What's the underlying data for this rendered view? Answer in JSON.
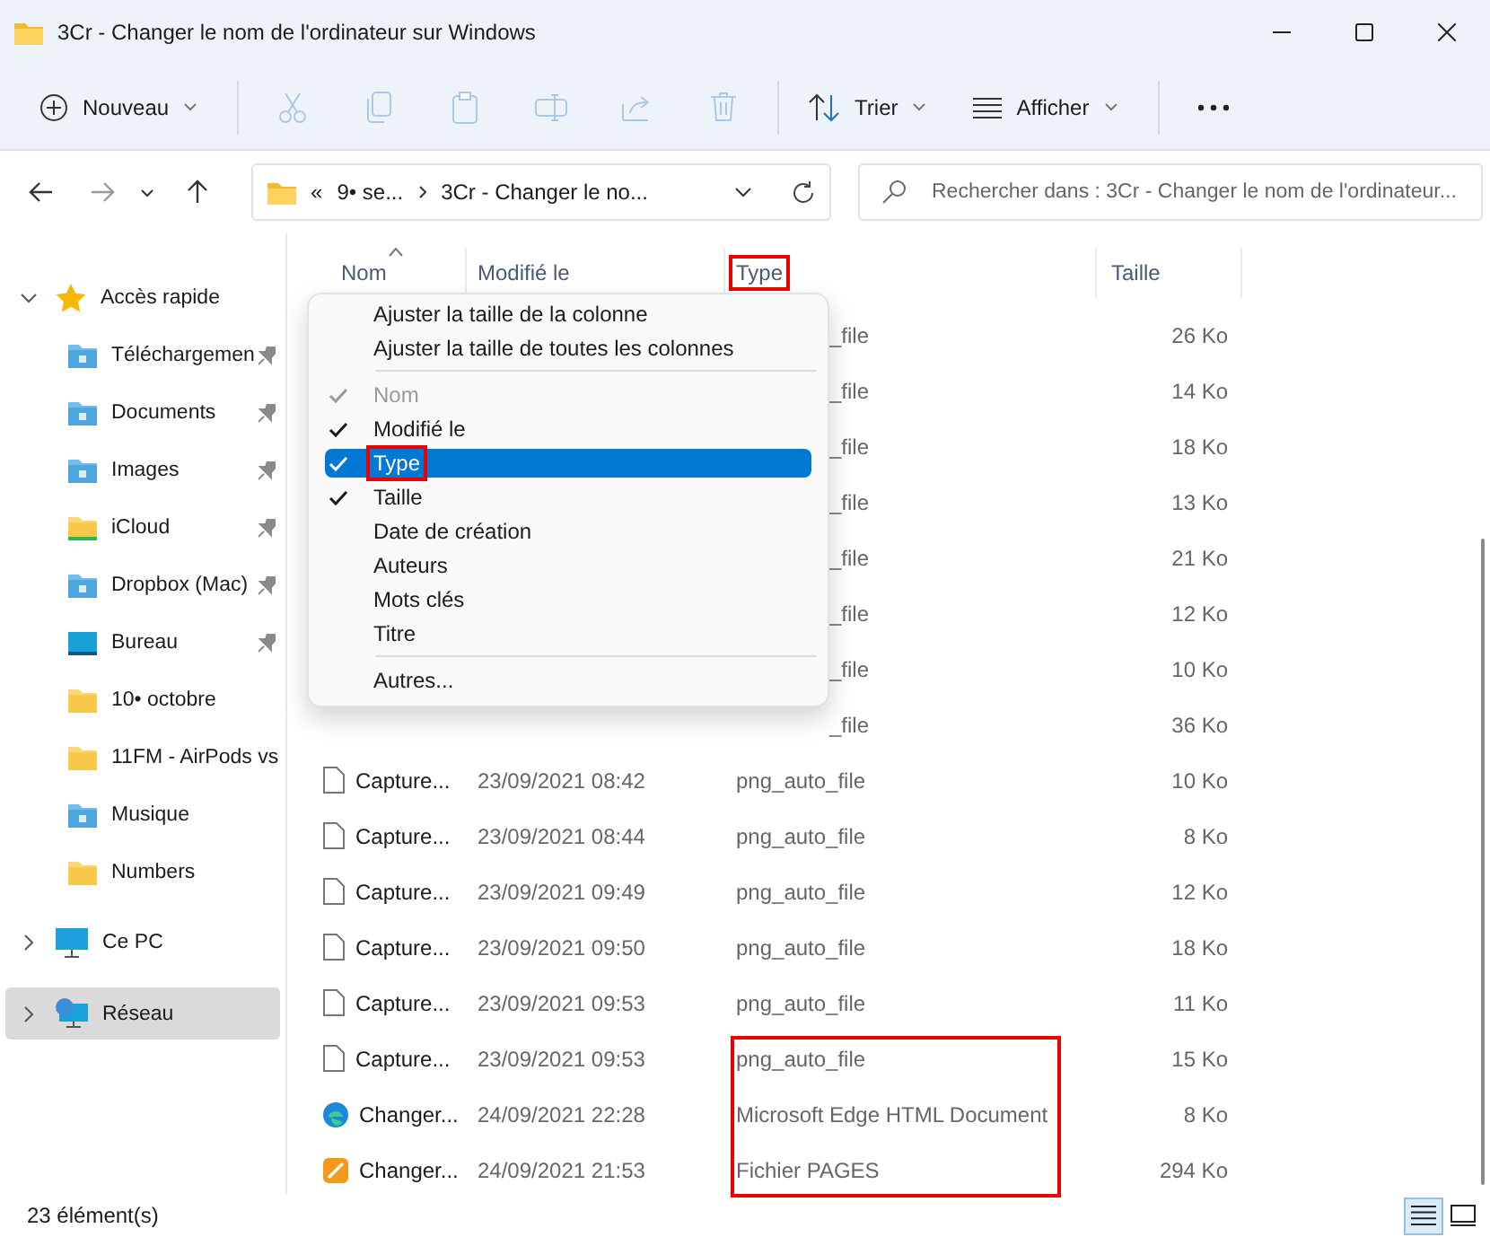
{
  "window": {
    "title": "3Cr - Changer le nom de l'ordinateur sur Windows"
  },
  "toolbar": [
    {
      "kind": "new",
      "label": "Nouveau",
      "disabled": false
    },
    {
      "kind": "separator"
    },
    {
      "kind": "cut",
      "disabled": true
    },
    {
      "kind": "copy",
      "disabled": true
    },
    {
      "kind": "paste",
      "disabled": true
    },
    {
      "kind": "rename",
      "disabled": true
    },
    {
      "kind": "share",
      "disabled": true
    },
    {
      "kind": "delete",
      "disabled": true
    },
    {
      "kind": "separator"
    },
    {
      "kind": "sort",
      "label": "Trier",
      "disabled": false
    },
    {
      "kind": "view",
      "label": "Afficher",
      "disabled": false
    },
    {
      "kind": "separator"
    },
    {
      "kind": "more"
    }
  ],
  "navigation": {
    "back_disabled": false,
    "forward_disabled": true
  },
  "address": {
    "crumbs": [
      "«",
      "9• se...",
      "3Cr - Changer le no..."
    ]
  },
  "search": {
    "placeholder": "Rechercher dans : 3Cr - Changer le nom de l'ordinateur..."
  },
  "sidebar": {
    "items": [
      {
        "label": "Accès rapide",
        "kind": "star",
        "expanded": true,
        "selected": false,
        "children": [
          {
            "label": "Téléchargemen",
            "kind": "download",
            "pinned": true,
            "selected": false
          },
          {
            "label": "Documents",
            "kind": "documents",
            "pinned": true,
            "selected": false
          },
          {
            "label": "Images",
            "kind": "images",
            "pinned": true,
            "selected": false
          },
          {
            "label": "iCloud",
            "kind": "icloud",
            "pinned": true,
            "selected": false
          },
          {
            "label": "Dropbox (Mac)",
            "kind": "dropbox",
            "pinned": true,
            "selected": false
          },
          {
            "label": "Bureau",
            "kind": "desktop",
            "pinned": true,
            "selected": false
          },
          {
            "label": "10• octobre",
            "kind": "folder",
            "pinned": false,
            "selected": false
          },
          {
            "label": "11FM - AirPods vs",
            "kind": "folder",
            "pinned": false,
            "selected": false
          },
          {
            "label": "Musique",
            "kind": "music",
            "pinned": false,
            "selected": false
          },
          {
            "label": "Numbers",
            "kind": "folder",
            "pinned": false,
            "selected": false
          }
        ]
      },
      {
        "label": "Ce PC",
        "kind": "pc",
        "expanded": false,
        "selected": false
      },
      {
        "label": "Réseau",
        "kind": "network",
        "expanded": false,
        "selected": true
      }
    ]
  },
  "file_list": {
    "columns": [
      {
        "label": "Nom",
        "sorted": true,
        "highlighted": false
      },
      {
        "label": "Modifié le",
        "sorted": false,
        "highlighted": false
      },
      {
        "label": "Type",
        "sorted": false,
        "highlighted": true
      },
      {
        "label": "Taille",
        "sorted": false,
        "highlighted": false
      }
    ],
    "rows": [
      {
        "kind": "covered",
        "type": "_file",
        "size": "26 Ko",
        "highlighted": false
      },
      {
        "kind": "covered",
        "type": "_file",
        "size": "14 Ko",
        "highlighted": false
      },
      {
        "kind": "covered",
        "type": "_file",
        "size": "18 Ko",
        "highlighted": false
      },
      {
        "kind": "covered",
        "type": "_file",
        "size": "13 Ko",
        "highlighted": false
      },
      {
        "kind": "covered",
        "type": "_file",
        "size": "21 Ko",
        "highlighted": false
      },
      {
        "kind": "covered",
        "type": "_file",
        "size": "12 Ko",
        "highlighted": false
      },
      {
        "kind": "covered",
        "type": "_file",
        "size": "10 Ko",
        "highlighted": false
      },
      {
        "kind": "covered",
        "type": "_file",
        "size": "36 Ko",
        "highlighted": false
      },
      {
        "kind": "file",
        "name": "Capture...",
        "modified": "23/09/2021 08:42",
        "type": "png_auto_file",
        "size": "10 Ko",
        "highlighted": false
      },
      {
        "kind": "file",
        "name": "Capture...",
        "modified": "23/09/2021 08:44",
        "type": "png_auto_file",
        "size": "8 Ko",
        "highlighted": false
      },
      {
        "kind": "file",
        "name": "Capture...",
        "modified": "23/09/2021 09:49",
        "type": "png_auto_file",
        "size": "12 Ko",
        "highlighted": false
      },
      {
        "kind": "file",
        "name": "Capture...",
        "modified": "23/09/2021 09:50",
        "type": "png_auto_file",
        "size": "18 Ko",
        "highlighted": false
      },
      {
        "kind": "file",
        "name": "Capture...",
        "modified": "23/09/2021 09:53",
        "type": "png_auto_file",
        "size": "11 Ko",
        "highlighted": false
      },
      {
        "kind": "file",
        "name": "Capture...",
        "modified": "23/09/2021 09:53",
        "type": "png_auto_file",
        "size": "15 Ko",
        "highlighted": true
      },
      {
        "kind": "edge",
        "name": "Changer...",
        "modified": "24/09/2021 22:28",
        "type": "Microsoft Edge HTML Document",
        "size": "8 Ko",
        "highlighted": true
      },
      {
        "kind": "pages",
        "name": "Changer...",
        "modified": "24/09/2021 21:53",
        "type": "Fichier PAGES",
        "size": "294 Ko",
        "highlighted": true
      }
    ]
  },
  "context_menu": {
    "items": [
      {
        "kind": "action",
        "label": "Ajuster la taille de la colonne",
        "selected": false
      },
      {
        "kind": "action",
        "label": "Ajuster la taille de toutes les colonnes",
        "selected": false
      },
      {
        "kind": "separator"
      },
      {
        "kind": "column",
        "label": "Nom",
        "checked": true,
        "disabled": true,
        "selected": false,
        "highlighted": false
      },
      {
        "kind": "column",
        "label": "Modifié le",
        "checked": true,
        "disabled": false,
        "selected": false,
        "highlighted": false
      },
      {
        "kind": "column",
        "label": "Type",
        "checked": true,
        "disabled": false,
        "selected": true,
        "highlighted": true
      },
      {
        "kind": "column",
        "label": "Taille",
        "checked": true,
        "disabled": false,
        "selected": false,
        "highlighted": false
      },
      {
        "kind": "column",
        "label": "Date de création",
        "checked": false,
        "disabled": false,
        "selected": false,
        "highlighted": false
      },
      {
        "kind": "column",
        "label": "Auteurs",
        "checked": false,
        "disabled": false,
        "selected": false,
        "highlighted": false
      },
      {
        "kind": "column",
        "label": "Mots clés",
        "checked": false,
        "disabled": false,
        "selected": false,
        "highlighted": false
      },
      {
        "kind": "column",
        "label": "Titre",
        "checked": false,
        "disabled": false,
        "selected": false,
        "highlighted": false
      },
      {
        "kind": "separator"
      },
      {
        "kind": "action",
        "label": "Autres...",
        "selected": false
      }
    ]
  },
  "status_bar": {
    "count": "23 élément(s)",
    "views": [
      {
        "kind": "details",
        "selected": true
      },
      {
        "kind": "tiles",
        "selected": false
      }
    ]
  }
}
